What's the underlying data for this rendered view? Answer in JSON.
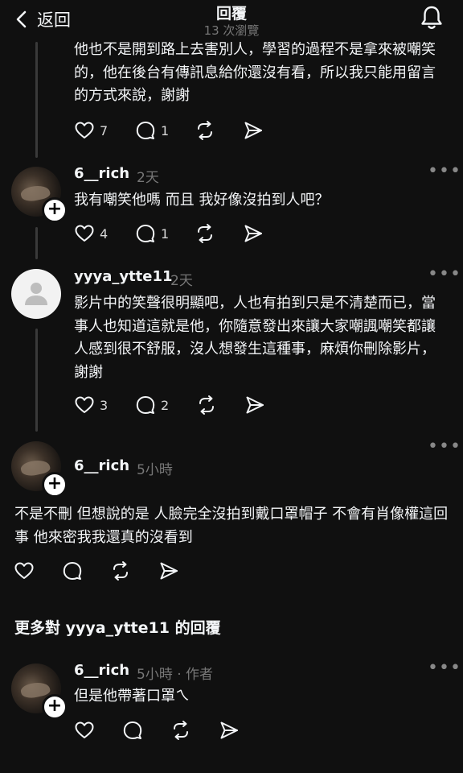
{
  "header": {
    "back_label": "返回",
    "title": "回覆",
    "views": "13 次瀏覽"
  },
  "posts": [
    {
      "text": "他也不是開到路上去害別人，學習的過程不是拿來被嘲笑的，他在後台有傳訊息給你還沒有看，所以我只能用留言的方式來說，謝謝",
      "likes": "7",
      "replies": "1"
    },
    {
      "username": "6__rich",
      "time": "2天",
      "text": "我有嘲笑他嗎 而且 我好像沒拍到人吧？",
      "likes": "4",
      "replies": "1"
    },
    {
      "username": "yyya_ytte11",
      "time": "2天",
      "text": "影片中的笑聲很明顯吧，人也有拍到只是不清楚而已，當事人也知道這就是他，你隨意發出來讓大家嘲諷嘲笑都讓人感到很不舒服，沒人想發生這種事，麻煩你刪除影片，謝謝",
      "likes": "3",
      "replies": "2"
    },
    {
      "username": "6__rich",
      "time": "5小時",
      "text": "不是不刪 但想說的是 人臉完全沒拍到戴口罩帽子 不會有肖像權這回事 他來密我我還真的沒看到"
    }
  ],
  "more_replies_title": "更多對 yyya_ytte11 的回覆",
  "last_post": {
    "username": "6__rich",
    "time": "5小時 · 作者",
    "text": "但是他帶著口罩ㄟ"
  },
  "icons": {
    "more": "•••",
    "plus": "+"
  }
}
